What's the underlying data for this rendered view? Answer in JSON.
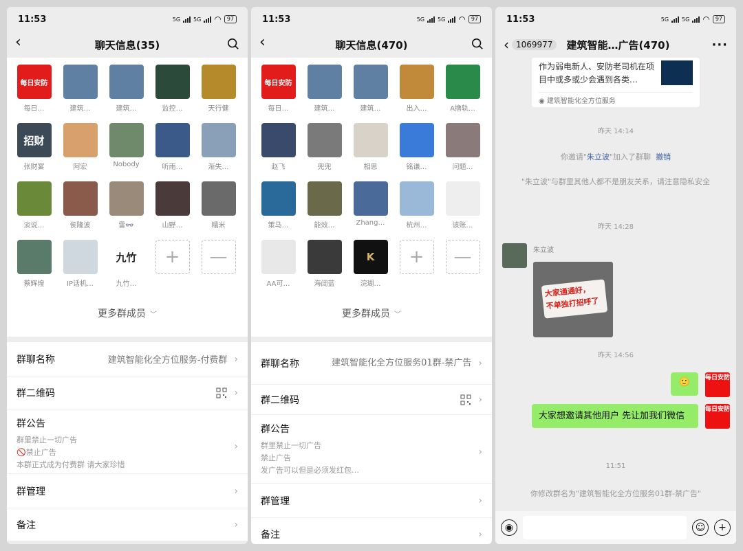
{
  "status": {
    "time": "11:53",
    "network": "5G",
    "battery": "97"
  },
  "screen1": {
    "title": "聊天信息(35)",
    "members": [
      {
        "name": "每日…",
        "avatar": "每日安防",
        "bg": "#e21b1b"
      },
      {
        "name": "建筑…",
        "avatar": "",
        "bg": "#5f7fa3"
      },
      {
        "name": "建筑…",
        "avatar": "",
        "bg": "#5f7fa3"
      },
      {
        "name": "监控…",
        "avatar": "",
        "bg": "#2b4a3a"
      },
      {
        "name": "天行健",
        "avatar": "",
        "bg": "#b48a2a"
      },
      {
        "name": "张财宴",
        "avatar": "招财",
        "bg": "#3c4a57"
      },
      {
        "name": "阿宏",
        "avatar": "",
        "bg": "#d8a06c"
      },
      {
        "name": "Nobody",
        "avatar": "",
        "bg": "#6e8a6a"
      },
      {
        "name": "听雨…",
        "avatar": "",
        "bg": "#3b5a8a"
      },
      {
        "name": "渐失…",
        "avatar": "",
        "bg": "#8aa0b8"
      },
      {
        "name": "淡说…",
        "avatar": "",
        "bg": "#6a8a3a"
      },
      {
        "name": "侯隆波",
        "avatar": "",
        "bg": "#8a5a4a"
      },
      {
        "name": "雷👓",
        "avatar": "",
        "bg": "#9a8a7a"
      },
      {
        "name": "山野…",
        "avatar": "",
        "bg": "#4a3a3a"
      },
      {
        "name": "糯米",
        "avatar": "",
        "bg": "#6a6a6a"
      },
      {
        "name": "蔡辉煌",
        "avatar": "",
        "bg": "#5a7a6a"
      },
      {
        "name": "IP话机…",
        "avatar": "",
        "bg": "#cfd8de"
      },
      {
        "name": "九竹…",
        "avatar": "九竹",
        "bg": "#ffffff"
      }
    ],
    "more_label": "更多群成员",
    "group_name_label": "群聊名称",
    "group_name_value": "建筑智能化全方位服务-付费群",
    "qr_label": "群二维码",
    "notice_label": "群公告",
    "notice_lines": [
      "群里禁止一切广告",
      "🚫禁止广告",
      "本群正式成为付费群 请大家珍惜"
    ],
    "manage_label": "群管理",
    "remark_label": "备注"
  },
  "screen2": {
    "title": "聊天信息(470)",
    "members": [
      {
        "name": "每日…",
        "avatar": "每日安防",
        "bg": "#e21b1b"
      },
      {
        "name": "建筑…",
        "avatar": "",
        "bg": "#5f7fa3"
      },
      {
        "name": "建筑…",
        "avatar": "",
        "bg": "#5f7fa3"
      },
      {
        "name": "出入…",
        "avatar": "",
        "bg": "#c08a3a"
      },
      {
        "name": "A撸轨…",
        "avatar": "",
        "bg": "#2a8a4a"
      },
      {
        "name": "赵飞",
        "avatar": "",
        "bg": "#3a4a6a"
      },
      {
        "name": "兜兜",
        "avatar": "",
        "bg": "#7a7a7a"
      },
      {
        "name": "相思",
        "avatar": "",
        "bg": "#d8d2c8"
      },
      {
        "name": "铭谦…",
        "avatar": "",
        "bg": "#3a7ad8"
      },
      {
        "name": "问题…",
        "avatar": "",
        "bg": "#8a7a7a"
      },
      {
        "name": "策马…",
        "avatar": "",
        "bg": "#2a6a9a"
      },
      {
        "name": "能效…",
        "avatar": "",
        "bg": "#6a6a4a"
      },
      {
        "name": "Zhang…",
        "avatar": "",
        "bg": "#4a6a9a"
      },
      {
        "name": "杭州…",
        "avatar": "",
        "bg": "#9ab8d8"
      },
      {
        "name": "该账…",
        "avatar": "",
        "bg": "#eeeeee"
      },
      {
        "name": "AA可…",
        "avatar": "",
        "bg": "#e8e8e8"
      },
      {
        "name": "海阔蓝",
        "avatar": "",
        "bg": "#3a3a3a"
      },
      {
        "name": "浣瑚…",
        "avatar": "K",
        "bg": "#111111"
      }
    ],
    "more_label": "更多群成员",
    "group_name_label": "群聊名称",
    "group_name_value": "建筑智能化全方位服务01群-禁广告",
    "qr_label": "群二维码",
    "notice_label": "群公告",
    "notice_lines": [
      "群里禁止一切广告",
      "禁止广告",
      "发广告可以但是必须发红包…"
    ],
    "manage_label": "群管理",
    "remark_label": "备注"
  },
  "chat": {
    "badge": "1069977",
    "title": "建筑智能…广告(470)",
    "card_text": "作为弱电新人、安防老司机在项目中或多或少会遇到各类…",
    "card_source": "建筑智能化全方位服务",
    "ts1": "昨天 14:14",
    "sys1_pre": "你邀请\"",
    "sys1_name": "朱立波",
    "sys1_post": "\"加入了群聊",
    "sys1_undo": "撤销",
    "sys2": "\"朱立波\"与群里其他人都不是朋友关系，请注意隐私安全",
    "ts2": "昨天 14:28",
    "sender": "朱立波",
    "img_line1": "大家通通好，",
    "img_line2": "不单独打招呼了",
    "ts3": "昨天 14:56",
    "sticker": "🙂",
    "my_avatar": "每日安防",
    "msg": "大家想邀请其他用户 先让加我们微信",
    "ts4": "11:51",
    "sys3": "你修改群名为\"建筑智能化全方位服务01群-禁广告\""
  },
  "colors": {
    "brand_red": "#e21b1b",
    "bubble_green": "#95ec69",
    "link_blue": "#3f64a9"
  }
}
